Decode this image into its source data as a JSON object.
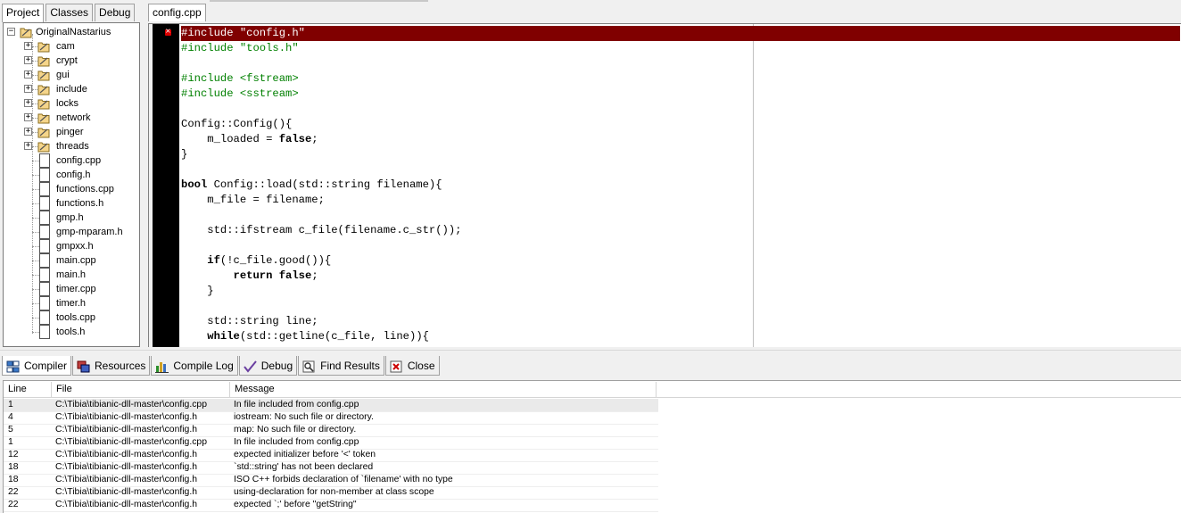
{
  "left_tabs": [
    "Project",
    "Classes",
    "Debug"
  ],
  "project": {
    "root": "OriginalNastarius",
    "folders": [
      "cam",
      "crypt",
      "gui",
      "include",
      "locks",
      "network",
      "pinger",
      "threads"
    ],
    "files": [
      "config.cpp",
      "config.h",
      "functions.cpp",
      "functions.h",
      "gmp.h",
      "gmp-mparam.h",
      "gmpxx.h",
      "main.cpp",
      "main.h",
      "timer.cpp",
      "timer.h",
      "tools.cpp",
      "tools.h"
    ]
  },
  "editor": {
    "tab": "config.cpp",
    "lines": [
      "#include \"config.h\"",
      "#include \"tools.h\"",
      "",
      "#include <fstream>",
      "#include <sstream>",
      "",
      "Config::Config(){",
      "    m_loaded = false;",
      "}",
      "",
      "bool Config::load(std::string filename){",
      "    m_file = filename;",
      "",
      "    std::ifstream c_file(filename.c_str());",
      "",
      "    if(!c_file.good()){",
      "        return false;",
      "    }",
      "",
      "    std::string line;",
      "    while(std::getline(c_file, line)){"
    ]
  },
  "bottom_tabs": [
    {
      "label": "Compiler",
      "icon": "compiler-icon"
    },
    {
      "label": "Resources",
      "icon": "resources-icon"
    },
    {
      "label": "Compile Log",
      "icon": "compile-log-icon"
    },
    {
      "label": "Debug",
      "icon": "debug-icon"
    },
    {
      "label": "Find Results",
      "icon": "find-results-icon"
    },
    {
      "label": "Close",
      "icon": "close-icon"
    }
  ],
  "compiler": {
    "columns": [
      "Line",
      "File",
      "Message"
    ],
    "rows": [
      {
        "line": "1",
        "file": "C:\\Tibia\\tibianic-dll-master\\config.cpp",
        "message": "In file included from config.cpp"
      },
      {
        "line": "4",
        "file": "C:\\Tibia\\tibianic-dll-master\\config.h",
        "message": "iostream: No such file or directory."
      },
      {
        "line": "5",
        "file": "C:\\Tibia\\tibianic-dll-master\\config.h",
        "message": "map: No such file or directory."
      },
      {
        "line": "1",
        "file": "C:\\Tibia\\tibianic-dll-master\\config.cpp",
        "message": "In file included from config.cpp"
      },
      {
        "line": "12",
        "file": "C:\\Tibia\\tibianic-dll-master\\config.h",
        "message": "expected initializer before '<' token"
      },
      {
        "line": "18",
        "file": "C:\\Tibia\\tibianic-dll-master\\config.h",
        "message": "`std::string' has not been declared"
      },
      {
        "line": "18",
        "file": "C:\\Tibia\\tibianic-dll-master\\config.h",
        "message": "ISO C++ forbids declaration of `filename' with no type"
      },
      {
        "line": "22",
        "file": "C:\\Tibia\\tibianic-dll-master\\config.h",
        "message": "using-declaration for non-member at class scope"
      },
      {
        "line": "22",
        "file": "C:\\Tibia\\tibianic-dll-master\\config.h",
        "message": "expected `;' before \"getString\""
      }
    ]
  },
  "colors": {
    "error_line_bg": "#800000",
    "preprocessor": "#008000",
    "gutter": "#000000"
  }
}
